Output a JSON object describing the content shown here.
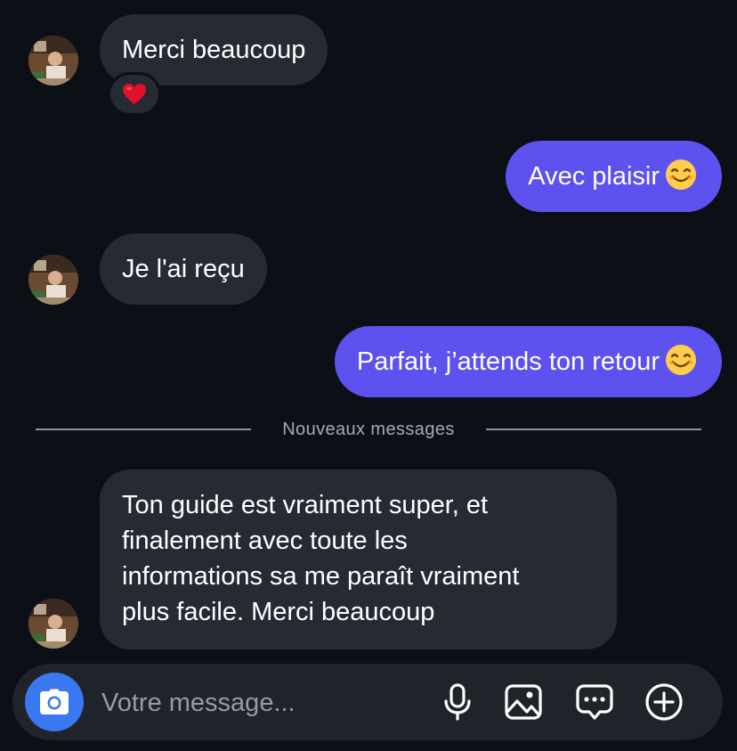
{
  "messages": [
    {
      "direction": "incoming",
      "text": "Merci beaucoup",
      "reaction": "heart"
    },
    {
      "direction": "outgoing",
      "text": "Avec plaisir",
      "emoji": "smiling-face"
    },
    {
      "direction": "incoming",
      "text": "Je l'ai reçu"
    },
    {
      "direction": "outgoing",
      "text": "Parfait, j’attends ton retour",
      "emoji": "smiling-face"
    }
  ],
  "divider": {
    "label": "Nouveaux messages"
  },
  "new_message": {
    "lines": [
      "Ton guide est vraiment super, et",
      "finalement avec toute les",
      "informations sa me paraît vraiment",
      "plus facile. Merci beaucoup"
    ]
  },
  "composer": {
    "placeholder": "Votre message...",
    "icons": [
      "camera-icon",
      "microphone-icon",
      "image-icon",
      "sticker-icon",
      "plus-circle-icon"
    ]
  },
  "colors": {
    "background": "#0c0f15",
    "incoming_bubble": "#262a33",
    "outgoing_bubble": "#5d51f0",
    "camera_button": "#3a78f2",
    "composer": "#202329"
  }
}
